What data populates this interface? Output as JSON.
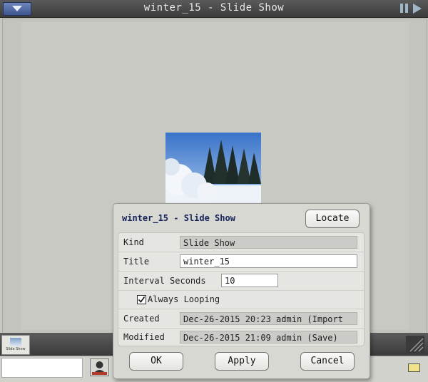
{
  "window": {
    "title": "winter_15 - Slide Show"
  },
  "thumbnail": {
    "label": "Slide Show"
  },
  "dialog": {
    "title": "winter_15 - Slide Show",
    "locate_label": "Locate",
    "fields": {
      "kind_label": "Kind",
      "kind_value": "Slide Show",
      "title_label": "Title",
      "title_value": "winter_15",
      "interval_label": "Interval Seconds",
      "interval_value": "10",
      "looping_label": "Always Looping",
      "looping_checked": true,
      "created_label": "Created",
      "created_value": "Dec-26-2015 20:23   admin   (Import",
      "modified_label": "Modified",
      "modified_value": "Dec-26-2015 21:09   admin   (Save)"
    },
    "buttons": {
      "ok": "OK",
      "apply": "Apply",
      "cancel": "Cancel"
    }
  },
  "colors": {
    "dialog_title": "#14245a",
    "titlebar": "#4a4a4a",
    "accent_blue": "#3c5590"
  }
}
